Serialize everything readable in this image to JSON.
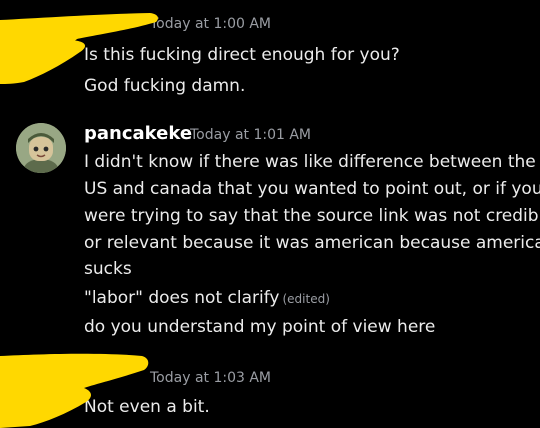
{
  "colors": {
    "background": "#000000",
    "text": "#ececec",
    "muted": "#9a9da3",
    "redaction": "#ffd800",
    "avatar_bg": "#98a784"
  },
  "group1": {
    "timestamp": "Today at 1:00 AM",
    "lines": [
      "Is this fucking direct enough for you?",
      "God fucking damn."
    ]
  },
  "group2": {
    "username": "pancakeke",
    "timestamp": "Today at 1:01 AM",
    "lines": [
      "I didn't know if there was like difference between the",
      "US and canada that you wanted to point out, or if you",
      "were trying to say that the source link was not credible",
      "or relevant because it was american because america",
      "sucks"
    ],
    "edited_line": "\"labor\" does not clarify",
    "edited_label": "(edited)",
    "last_line": "do you understand my point of view here"
  },
  "group3": {
    "timestamp": "Today at 1:03 AM",
    "lines": [
      "Not even a bit."
    ]
  },
  "icons": {
    "avatar": "avatar-icon",
    "redaction": "redaction-scribble"
  }
}
